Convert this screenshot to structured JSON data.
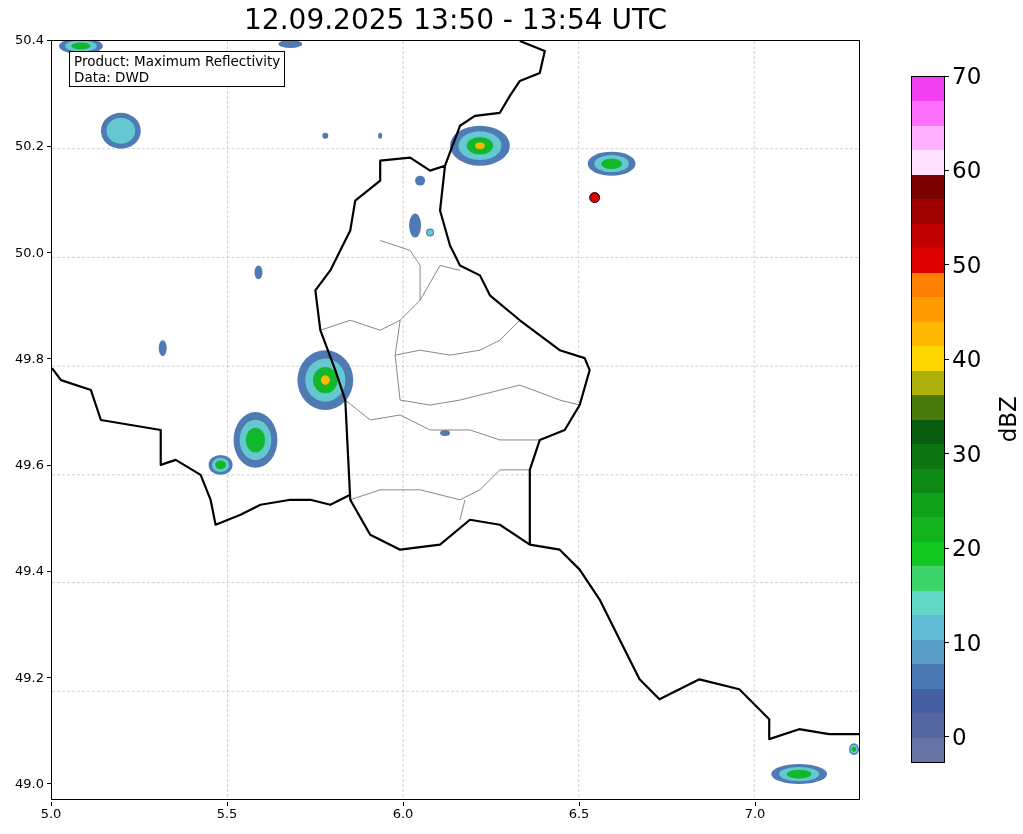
{
  "title": "12.09.2025 13:50 - 13:54 UTC",
  "legend": [
    "Product: Maximum Reflectivity",
    "Data: DWD"
  ],
  "y_ticks": [
    "50.4",
    "50.2",
    "50.0",
    "49.8",
    "49.6",
    "49.4",
    "49.2",
    "49.0"
  ],
  "x_ticks": [
    "5.0",
    "5.5",
    "6.0",
    "6.5",
    "7.0"
  ],
  "colorbar": {
    "label": "dBZ",
    "ticks": [
      "70",
      "60",
      "50",
      "40",
      "30",
      "20",
      "10",
      "0"
    ],
    "bins": [
      {
        "color": "#f040f0"
      },
      {
        "color": "#ff70ff"
      },
      {
        "color": "#ffb0ff"
      },
      {
        "color": "#ffe0ff"
      },
      {
        "color": "#7a0000"
      },
      {
        "color": "#a00000"
      },
      {
        "color": "#c00000"
      },
      {
        "color": "#e00000"
      },
      {
        "color": "#ff7f00"
      },
      {
        "color": "#ff9a00"
      },
      {
        "color": "#ffb700"
      },
      {
        "color": "#ffd700"
      },
      {
        "color": "#aeb00a"
      },
      {
        "color": "#4a7a0c"
      },
      {
        "color": "#0a5c10"
      },
      {
        "color": "#0c7412"
      },
      {
        "color": "#0e8a14"
      },
      {
        "color": "#10a01a"
      },
      {
        "color": "#12b31c"
      },
      {
        "color": "#14c822"
      },
      {
        "color": "#3ed46c"
      },
      {
        "color": "#62d8c6"
      },
      {
        "color": "#62bcd6"
      },
      {
        "color": "#5a9ec8"
      },
      {
        "color": "#4a78b2"
      },
      {
        "color": "#4560a0"
      },
      {
        "color": "#5565a0"
      },
      {
        "color": "#6574a5"
      }
    ]
  }
}
